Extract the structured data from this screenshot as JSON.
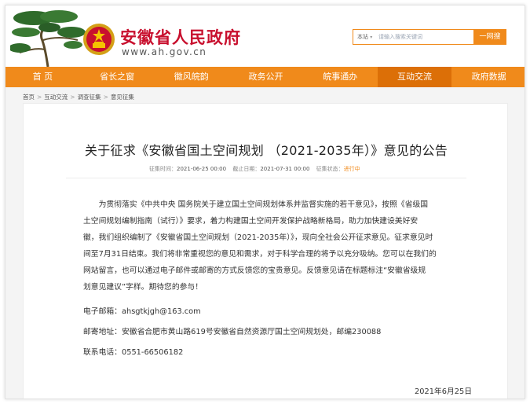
{
  "header": {
    "site_title": "安徽省人民政府",
    "site_url": "www.ah.gov.cn",
    "search": {
      "scope": "本站",
      "placeholder": "请输入搜索关键词",
      "button_label": "一网搜"
    }
  },
  "nav": {
    "items": [
      {
        "label": "首 页"
      },
      {
        "label": "省长之窗"
      },
      {
        "label": "徽风皖韵"
      },
      {
        "label": "政务公开"
      },
      {
        "label": "皖事通办"
      },
      {
        "label": "互动交流"
      },
      {
        "label": "政府数据"
      }
    ],
    "active_index": 5
  },
  "breadcrumb": {
    "items": [
      "首页",
      "互动交流",
      "调查征集",
      "意见征集"
    ],
    "separator": ">"
  },
  "article": {
    "title": "关于征求《安徽省国土空间规划 （2021-2035年）》意见的公告",
    "meta": {
      "start_label": "征集时间：",
      "start_value": "2021-06-25 00:00",
      "end_label": "截止日期：",
      "end_value": "2021-07-31 00:00",
      "status_label": "征集状态：",
      "status_value": "进行中"
    },
    "paragraph_lines": [
      "为贯彻落实《中共中央 国务院关于建立国土空间规划体系并监督实施的若干意见》，按照《省级国",
      "土空间规划编制指南（试行）》要求，着力构建国土空间开发保护战略新格局，助力加快建设美好安",
      "徽，我们组织编制了《安徽省国土空间规划（2021-2035年）》，现向全社会公开征求意见。征求意见时",
      "间至7月31日结束。我们将非常重视您的意见和需求，对于科学合理的将予以充分吸纳。您可以在我们的",
      "网站留言，也可以通过电子邮件或邮寄的方式反馈您的宝贵意见。反馈意见请在标题标注“安徽省级规",
      "划意见建议”字样。期待您的参与！"
    ],
    "email": "电子邮箱：ahsgtkjgh@163.com",
    "address": "邮寄地址：安徽省合肥市黄山路619号安徽省自然资源厅国土空间规划处，邮编230088",
    "phone": "联系电话：0551-66506182",
    "date": "2021年6月25日"
  },
  "colors": {
    "brand_orange": "#f08a1b",
    "active_orange": "#dc6f07",
    "title_red": "#c8102e"
  },
  "icons": [
    "pine-tree-logo-icon",
    "national-emblem-icon"
  ]
}
